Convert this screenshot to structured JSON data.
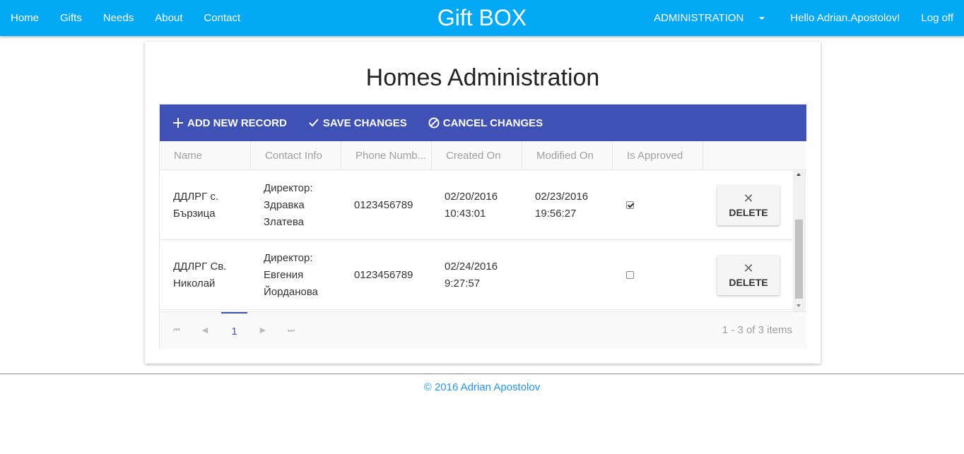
{
  "nav": {
    "left": [
      "Home",
      "Gifts",
      "Needs",
      "About",
      "Contact"
    ],
    "brand": "Gift BOX",
    "admin": "ADMINISTRATION",
    "hello": "Hello Adrian.Apostolov!",
    "logoff": "Log off"
  },
  "page": {
    "title": "Homes Administration"
  },
  "toolbar": {
    "add": "ADD NEW RECORD",
    "save": "SAVE CHANGES",
    "cancel": "CANCEL CHANGES"
  },
  "grid": {
    "columns": [
      "Name",
      "Contact Info",
      "Phone Numb...",
      "Created On",
      "Modified On",
      "Is Approved"
    ],
    "rows": [
      {
        "name": [
          "ДДЛРГ с.",
          "Бързица"
        ],
        "contact": [
          "Директор:",
          "Здравка",
          "Златева"
        ],
        "phone": "0123456789",
        "created": [
          "02/20/2016",
          "10:43:01"
        ],
        "modified": [
          "02/23/2016",
          "19:56:27"
        ],
        "approved": true,
        "delete": "DELETE"
      },
      {
        "name": [
          "ДДЛРГ Св.",
          "Николай"
        ],
        "contact": [
          "Директор:",
          "Евгения",
          "Йорданова"
        ],
        "phone": "0123456789",
        "created": [
          "02/24/2016",
          "9:27:57"
        ],
        "modified": [
          "",
          ""
        ],
        "approved": false,
        "delete": "DELETE"
      }
    ],
    "pager": {
      "page": "1",
      "info": "1 - 3 of 3 items"
    }
  },
  "footer": {
    "text": "© 2016 Adrian Apostolov"
  },
  "colors": {
    "navbar": "#03a9f4",
    "toolbar": "#3f51b5",
    "footer_text": "#2196f3"
  }
}
